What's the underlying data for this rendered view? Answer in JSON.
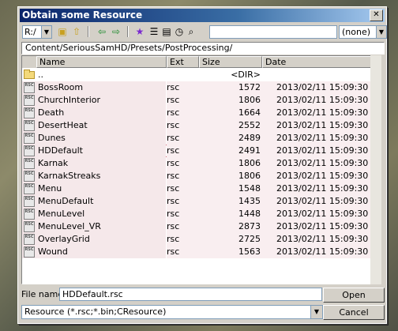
{
  "window": {
    "title": "Obtain some Resource",
    "close_glyph": "✕"
  },
  "toolbar": {
    "drive": "R:/",
    "search_value": "",
    "filter": "(none)",
    "icons": [
      "folder-icon",
      "folder-up-icon",
      "back-arrow-icon",
      "forward-arrow-icon",
      "star-icon",
      "list-view-icon",
      "details-view-icon",
      "clock-icon",
      "find-icon",
      "bookmark-icon"
    ]
  },
  "path": "Content/SeriousSamHD/Presets/PostProcessing/",
  "columns": {
    "name": "Name",
    "ext": "Ext",
    "size": "Size",
    "date": "Date"
  },
  "dir_row": {
    "name": "..",
    "size": "<DIR>"
  },
  "files": [
    {
      "name": "BossRoom",
      "ext": "rsc",
      "size": "1572",
      "date": "2013/02/11 15:09:30"
    },
    {
      "name": "ChurchInterior",
      "ext": "rsc",
      "size": "1806",
      "date": "2013/02/11 15:09:30"
    },
    {
      "name": "Death",
      "ext": "rsc",
      "size": "1664",
      "date": "2013/02/11 15:09:30"
    },
    {
      "name": "DesertHeat",
      "ext": "rsc",
      "size": "2552",
      "date": "2013/02/11 15:09:30"
    },
    {
      "name": "Dunes",
      "ext": "rsc",
      "size": "2489",
      "date": "2013/02/11 15:09:30"
    },
    {
      "name": "HDDefault",
      "ext": "rsc",
      "size": "2491",
      "date": "2013/02/11 15:09:30"
    },
    {
      "name": "Karnak",
      "ext": "rsc",
      "size": "1806",
      "date": "2013/02/11 15:09:30"
    },
    {
      "name": "KarnakStreaks",
      "ext": "rsc",
      "size": "1806",
      "date": "2013/02/11 15:09:30"
    },
    {
      "name": "Menu",
      "ext": "rsc",
      "size": "1548",
      "date": "2013/02/11 15:09:30"
    },
    {
      "name": "MenuDefault",
      "ext": "rsc",
      "size": "1435",
      "date": "2013/02/11 15:09:30"
    },
    {
      "name": "MenuLevel",
      "ext": "rsc",
      "size": "1448",
      "date": "2013/02/11 15:09:30"
    },
    {
      "name": "MenuLevel_VR",
      "ext": "rsc",
      "size": "2873",
      "date": "2013/02/11 15:09:30"
    },
    {
      "name": "OverlayGrid",
      "ext": "rsc",
      "size": "2725",
      "date": "2013/02/11 15:09:30"
    },
    {
      "name": "Wound",
      "ext": "rsc",
      "size": "1563",
      "date": "2013/02/11 15:09:30"
    }
  ],
  "file_icon_text": "RSC",
  "file_name": {
    "label": "File name:",
    "value": "HDDefault.rsc"
  },
  "file_type": "Resource (*.rsc;*.bin;CResource)",
  "buttons": {
    "open": "Open",
    "cancel": "Cancel"
  }
}
